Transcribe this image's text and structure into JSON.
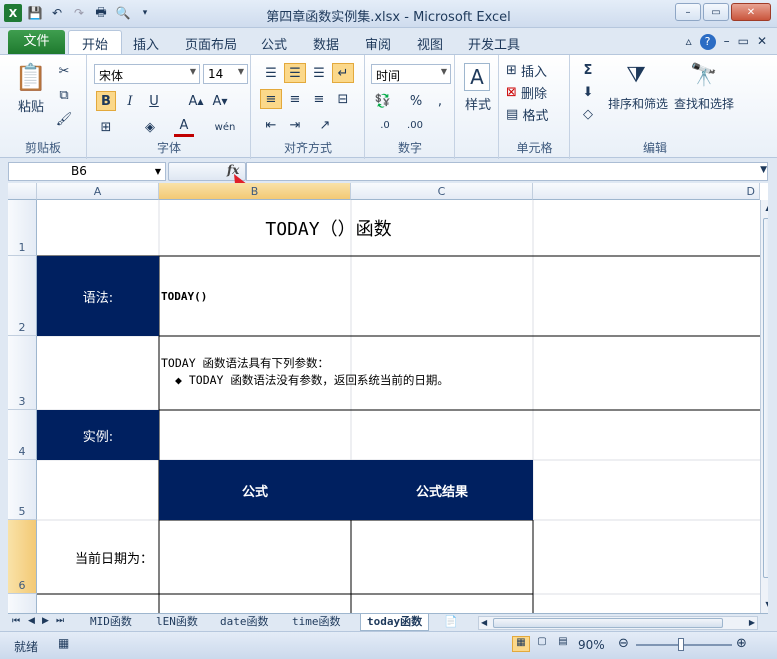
{
  "window": {
    "title": "第四章函数实例集.xlsx - Microsoft Excel"
  },
  "ribbon_tabs": [
    {
      "label": "文件"
    },
    {
      "label": "开始"
    },
    {
      "label": "插入"
    },
    {
      "label": "页面布局"
    },
    {
      "label": "公式"
    },
    {
      "label": "数据"
    },
    {
      "label": "审阅"
    },
    {
      "label": "视图"
    },
    {
      "label": "开发工具"
    }
  ],
  "ribbon": {
    "clipboard": {
      "paste": "粘贴",
      "group": "剪贴板"
    },
    "font": {
      "name": "宋体",
      "size": "14",
      "group": "字体",
      "bold": "B",
      "italic": "I",
      "underline": "U"
    },
    "alignment": {
      "group": "对齐方式"
    },
    "number": {
      "format": "时间",
      "group": "数字",
      "percent": "%"
    },
    "styles": {
      "label": "样式"
    },
    "cells": {
      "insert": "插入",
      "delete": "删除",
      "format": "格式",
      "group": "单元格"
    },
    "editing": {
      "sort": "排序和筛选",
      "find": "查找和选择",
      "group": "编辑"
    }
  },
  "formula_bar": {
    "name_box": "B6",
    "fx": "fx",
    "content": ""
  },
  "columns": [
    "A",
    "B",
    "C",
    "D"
  ],
  "rows": [
    "1",
    "2",
    "3",
    "4",
    "5",
    "6"
  ],
  "sheet": {
    "title": "TODAY（）函数",
    "syntax_label": "语法:",
    "syntax_value": "TODAY()",
    "params_line1": "TODAY 函数语法具有下列参数：",
    "params_line2": "◆ TODAY 函数语法没有参数，返回系统当前的日期。",
    "example_label": "实例:",
    "formula_header": "公式",
    "result_header": "公式结果",
    "current_date_label": "当前日期为："
  },
  "sheet_tabs": [
    {
      "label": "MID函数"
    },
    {
      "label": "lEN函数"
    },
    {
      "label": "date函数"
    },
    {
      "label": "time函数"
    },
    {
      "label": "today函数"
    }
  ],
  "status": {
    "ready": "就绪",
    "zoom": "90%"
  },
  "colors": {
    "navy": "#002060",
    "file_tab": "#2a8a3a"
  }
}
